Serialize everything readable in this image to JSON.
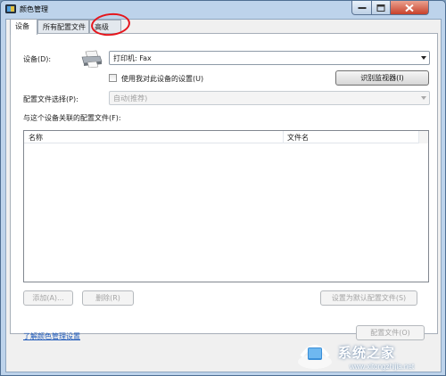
{
  "window": {
    "title": "颜色管理"
  },
  "tabs": [
    {
      "label": "设备",
      "active": true
    },
    {
      "label": "所有配置文件",
      "active": false
    },
    {
      "label": "高级",
      "active": false
    }
  ],
  "device": {
    "label": "设备(D):",
    "selected": "打印机: Fax",
    "use_my_settings_label": "使用我对此设备的设置(U)",
    "use_my_settings_checked": false,
    "identify_monitors_button": "识别监视器(I)"
  },
  "profile_selection": {
    "label": "配置文件选择(P):",
    "selected": "自动(推荐)",
    "enabled": false
  },
  "associated_profiles": {
    "label": "与这个设备关联的配置文件(F):",
    "columns": [
      "名称",
      "文件名"
    ],
    "rows": []
  },
  "buttons": {
    "add": "添加(A)...",
    "remove": "删除(R)",
    "set_default": "设置为默认配置文件(S)",
    "profiles": "配置文件(O)"
  },
  "link": "了解颜色管理设置",
  "watermark": {
    "text": "系统之家",
    "url": "www.xitongzhijia.net"
  },
  "colors": {
    "annotation": "#e5151c",
    "link": "#1a56b8",
    "title_bar": "#bdd3eb"
  }
}
